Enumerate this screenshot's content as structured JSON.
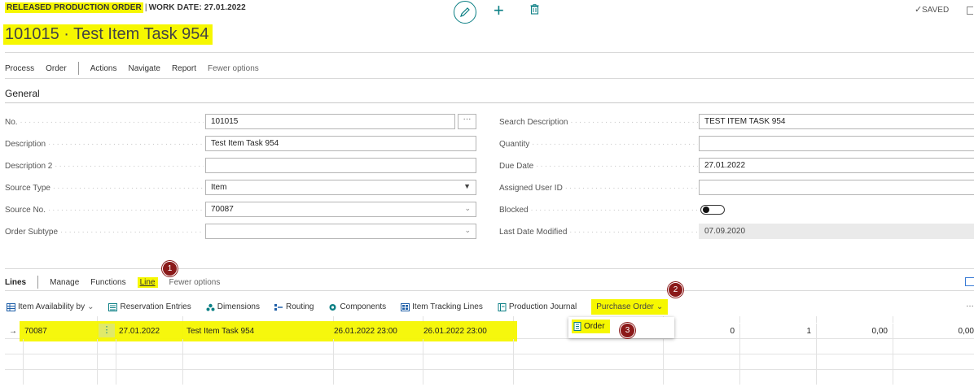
{
  "header": {
    "page_type": "RELEASED PRODUCTION ORDER",
    "separator": "|",
    "work_date": "WORK DATE: 27.01.2022",
    "title": "101015 · Test Item Task 954",
    "saved": "SAVED",
    "accent_color": "#0b7f84",
    "icons": [
      "pencil-icon",
      "plus-icon",
      "trash-icon",
      "checkmark-icon"
    ]
  },
  "actions": {
    "process": "Process",
    "order": "Order",
    "actions": "Actions",
    "navigate": "Navigate",
    "report": "Report",
    "fewer_options": "Fewer options"
  },
  "general": {
    "title": "General",
    "left": [
      {
        "label": "No.",
        "value": "101015"
      },
      {
        "label": "Description",
        "value": "Test Item Task 954"
      },
      {
        "label": "Description 2",
        "value": ""
      },
      {
        "label": "Source Type",
        "value": "Item"
      },
      {
        "label": "Source No.",
        "value": "70087"
      },
      {
        "label": "Order Subtype",
        "value": ""
      }
    ],
    "right": [
      {
        "label": "Search Description",
        "value": "TEST ITEM TASK 954"
      },
      {
        "label": "Quantity",
        "value": ""
      },
      {
        "label": "Due Date",
        "value": "27.01.2022"
      },
      {
        "label": "Assigned User ID",
        "value": ""
      },
      {
        "label": "Blocked",
        "value": ""
      },
      {
        "label": "Last Date Modified",
        "value": "07.09.2020"
      }
    ],
    "assist": "···"
  },
  "lines": {
    "title": "Lines",
    "manage": "Manage",
    "functions": "Functions",
    "line": "Line",
    "fewer_options": "Fewer options",
    "toolbar": {
      "item_availability": "Item Availability by",
      "reservation_entries": "Reservation Entries",
      "dimensions": "Dimensions",
      "routing": "Routing",
      "components": "Components",
      "item_tracking": "Item Tracking Lines",
      "production_journal": "Production Journal",
      "purchase_order": "Purchase Order"
    },
    "dropdown_order": "Order",
    "row": {
      "arrow": "→",
      "item_no": "70087",
      "menu": "⋮",
      "due_date": "27.01.2022",
      "description": "Test Item Task 954",
      "starting": "26.01.2022 23:00",
      "ending": "26.01.2022 23:00",
      "col_a": "0",
      "col_b": "1",
      "col_c": "0,00",
      "col_d": "0,00"
    }
  },
  "markers": {
    "m1": "1",
    "m2": "2",
    "m3": "3"
  },
  "highlight_color": "#f6f700"
}
